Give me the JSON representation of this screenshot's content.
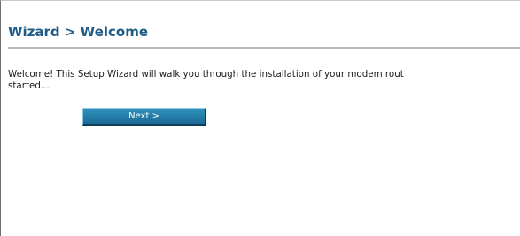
{
  "header": {
    "title": "Wizard > Welcome"
  },
  "main": {
    "welcome_line_1": "Welcome! This Setup Wizard will walk you through the installation of your modem rout",
    "welcome_line_2": "started...",
    "next_label": "Next >"
  },
  "colors": {
    "title": "#1f5b86",
    "button": "#1f749f",
    "divider": "#b9b9b9"
  }
}
